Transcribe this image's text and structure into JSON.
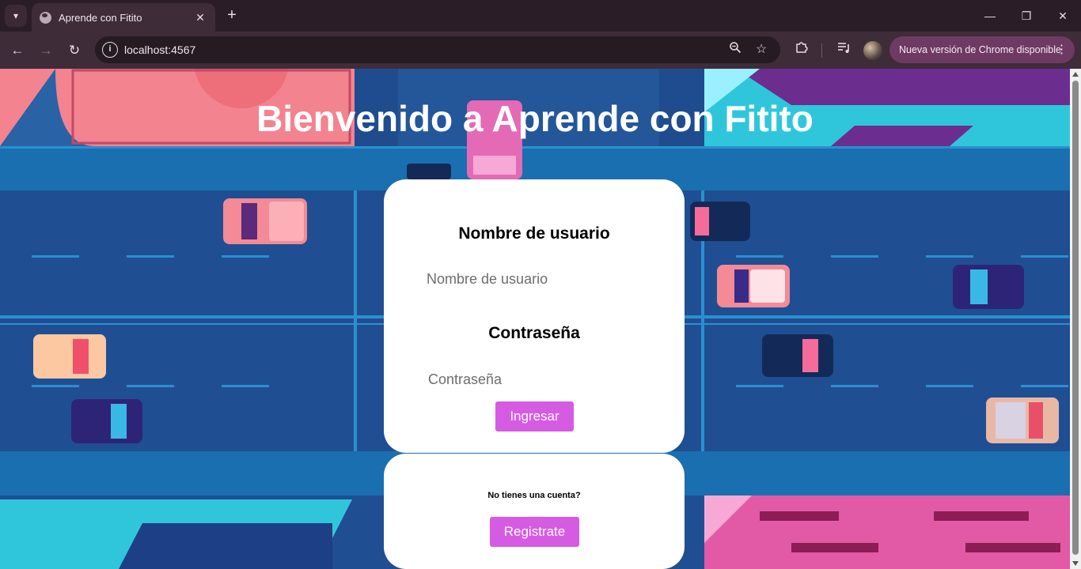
{
  "browser": {
    "tab_title": "Aprende con Fitito",
    "url": "localhost:4567",
    "update_notice": "Nueva versión de Chrome disponible"
  },
  "page": {
    "heading": "Bienvenido a Aprende con Fitito",
    "login": {
      "username_label": "Nombre de usuario",
      "username_placeholder": "Nombre de usuario",
      "password_label": "Contraseña",
      "password_placeholder": "Contraseña",
      "submit_label": "Ingresar"
    },
    "register": {
      "prompt": "No tienes una cuenta?",
      "button_label": "Registrate"
    }
  },
  "colors": {
    "accent_button": "#d65be3",
    "road_blue": "#1f4f92"
  }
}
